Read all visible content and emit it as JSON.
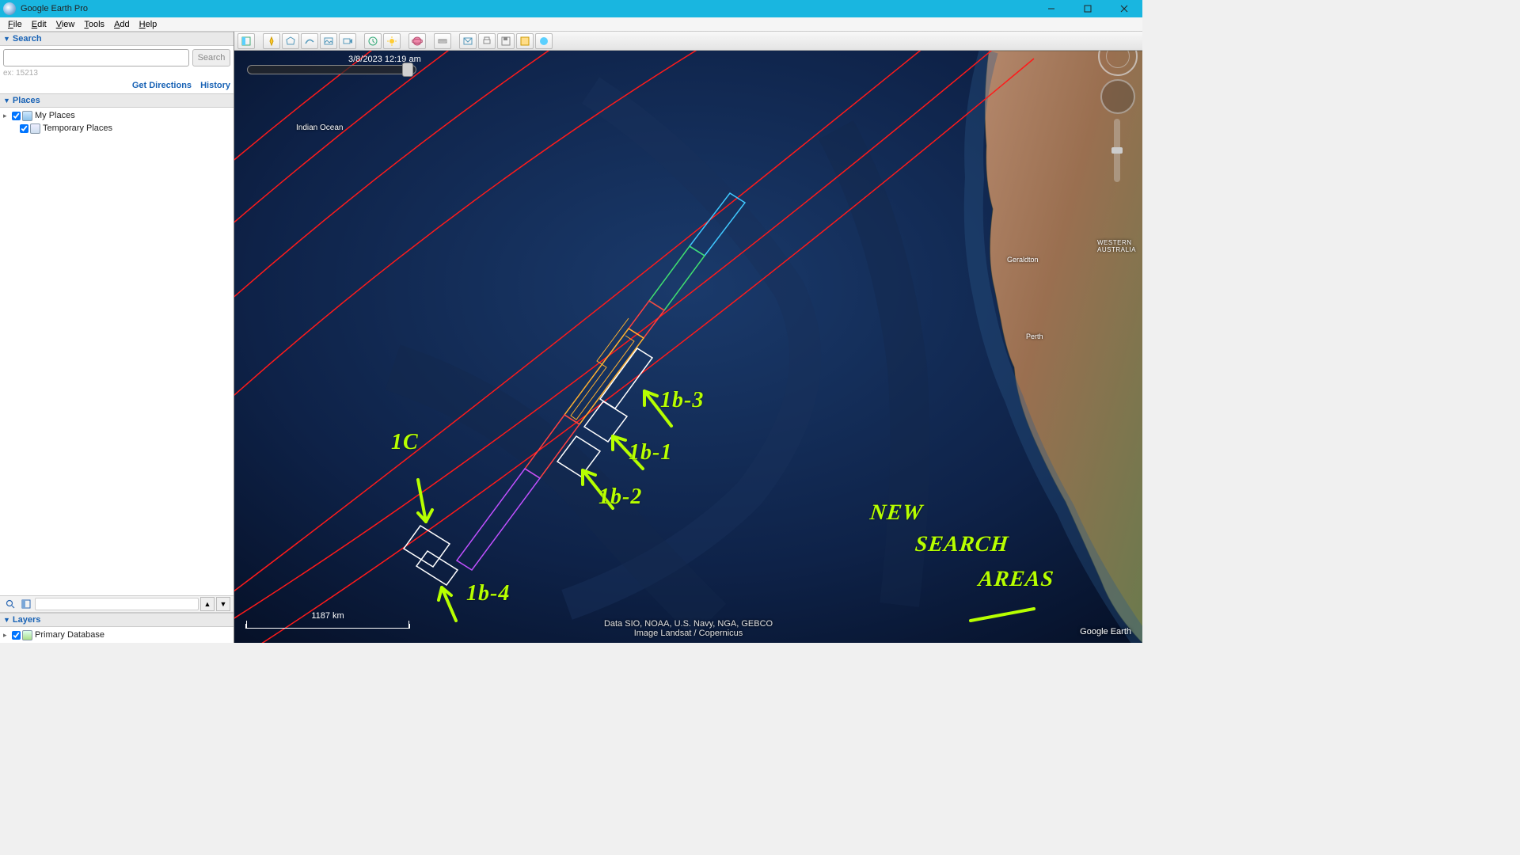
{
  "window": {
    "title": "Google Earth Pro"
  },
  "menu": {
    "file": "File",
    "edit": "Edit",
    "view": "View",
    "tools": "Tools",
    "add": "Add",
    "help": "Help"
  },
  "search": {
    "heading": "Search",
    "value": "",
    "button": "Search",
    "hint": "ex: 15213",
    "get_directions": "Get Directions",
    "history": "History"
  },
  "places": {
    "heading": "Places",
    "items": [
      {
        "label": "My Places",
        "checked": true
      },
      {
        "label": "Temporary Places",
        "checked": true
      }
    ]
  },
  "layers": {
    "heading": "Layers",
    "items": [
      {
        "label": "Primary Database",
        "checked": true
      }
    ]
  },
  "map": {
    "timestamp": "3/8/2023  12:19 am",
    "ocean_label": "Indian Ocean",
    "city_labels": [
      "Geraldton",
      "Perth"
    ],
    "region_label": "WESTERN AUSTRALIA",
    "scale": "1187 km",
    "attribution_1": "Data SIO, NOAA, U.S. Navy, NGA, GEBCO",
    "attribution_2": "Image Landsat / Copernicus",
    "logo": "Google Earth",
    "compass": "N"
  },
  "annotations": {
    "a1c": "1C",
    "a1b4": "1b-4",
    "a1b2": "1b-2",
    "a1b1": "1b-1",
    "a1b3": "1b-3",
    "title_l1": "NEW",
    "title_l2": "SEARCH",
    "title_l3": "AREAS"
  }
}
